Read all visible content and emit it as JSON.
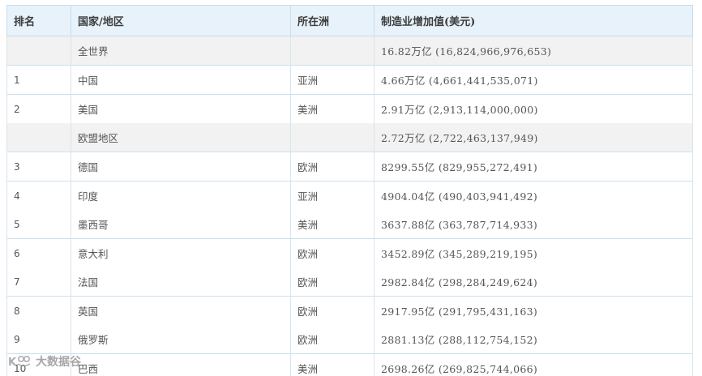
{
  "table": {
    "headers": [
      "排名",
      "国家/地区",
      "所在洲",
      "制造业增加值(美元)"
    ],
    "rows": [
      {
        "rank": "",
        "country": "全世界",
        "continent": "",
        "value": "16.82万亿 (16,824,966,976,653)",
        "shaded": true,
        "sep": true
      },
      {
        "rank": "1",
        "country": "中国",
        "continent": "亚洲",
        "value": "4.66万亿 (4,661,441,535,071)",
        "shaded": false,
        "sep": true
      },
      {
        "rank": "2",
        "country": "美国",
        "continent": "美洲",
        "value": "2.91万亿 (2,913,114,000,000)",
        "shaded": false,
        "sep": true
      },
      {
        "rank": "",
        "country": "欧盟地区",
        "continent": "",
        "value": "2.72万亿 (2,722,463,137,949)",
        "shaded": true,
        "sep": false
      },
      {
        "rank": "3",
        "country": "德国",
        "continent": "欧洲",
        "value": "8299.55亿 (829,955,272,491)",
        "shaded": false,
        "sep": true
      },
      {
        "rank": "4",
        "country": "印度",
        "continent": "亚洲",
        "value": "4904.04亿 (490,403,941,492)",
        "shaded": false,
        "sep": true
      },
      {
        "rank": "5",
        "country": "墨西哥",
        "continent": "美洲",
        "value": "3637.88亿 (363,787,714,933)",
        "shaded": false,
        "sep": false
      },
      {
        "rank": "6",
        "country": "意大利",
        "continent": "欧洲",
        "value": "3452.89亿 (345,289,219,195)",
        "shaded": false,
        "sep": true
      },
      {
        "rank": "7",
        "country": "法国",
        "continent": "欧洲",
        "value": "2982.84亿 (298,284,249,624)",
        "shaded": false,
        "sep": false
      },
      {
        "rank": "8",
        "country": "英国",
        "continent": "欧洲",
        "value": "2917.95亿 (291,795,431,163)",
        "shaded": false,
        "sep": true
      },
      {
        "rank": "9",
        "country": "俄罗斯",
        "continent": "欧洲",
        "value": "2881.13亿 (288,112,754,152)",
        "shaded": false,
        "sep": false
      },
      {
        "rank": "10",
        "country": "巴西",
        "continent": "美洲",
        "value": "2698.26亿 (269,825,744,066)",
        "shaded": false,
        "sep": true
      }
    ]
  },
  "watermark": {
    "text": "大数据谷"
  }
}
